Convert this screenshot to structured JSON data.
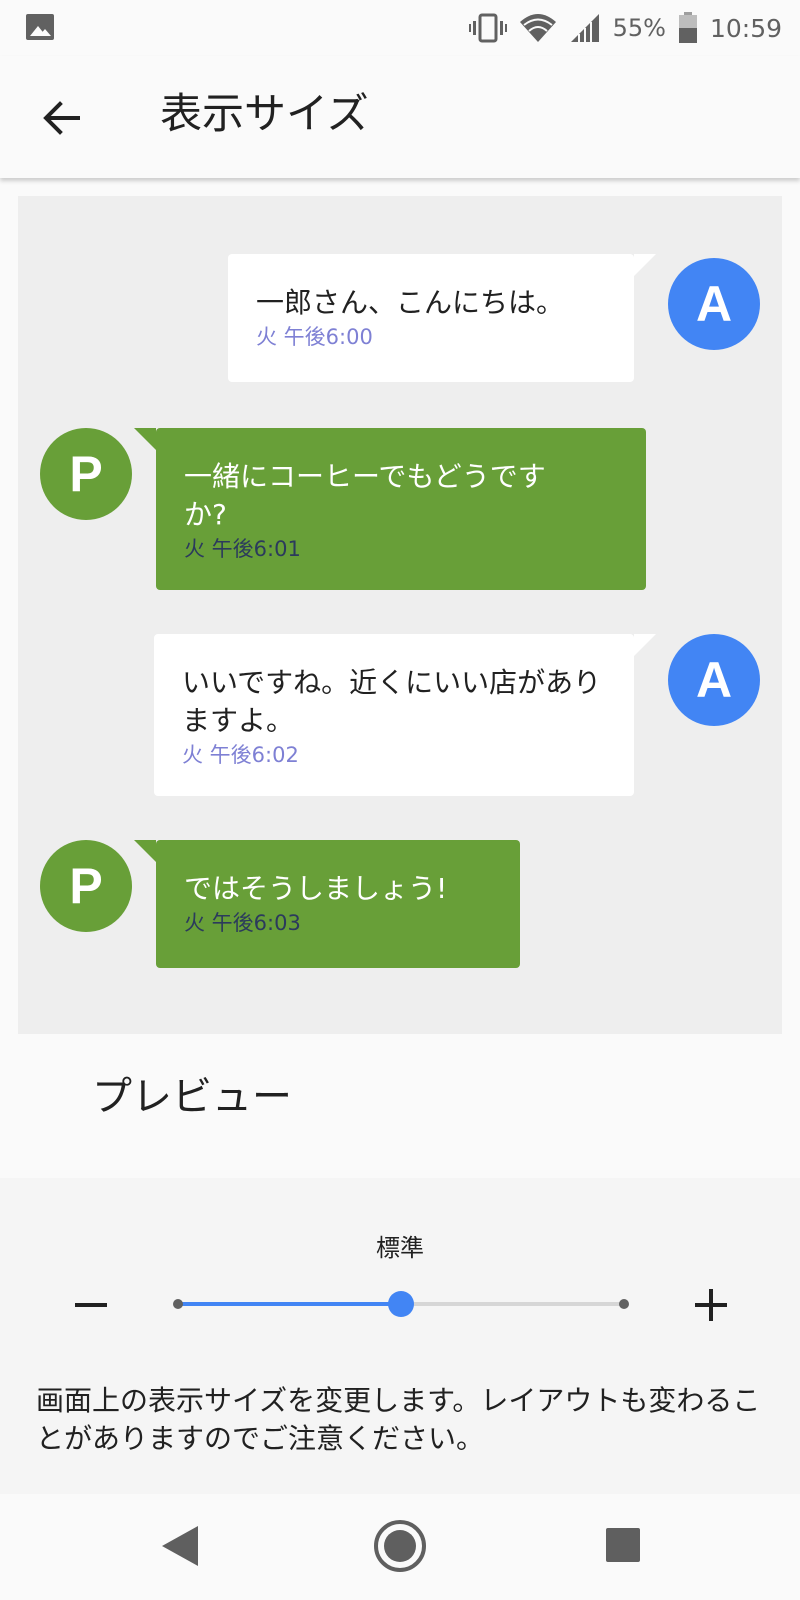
{
  "status_bar": {
    "battery_percent": "55%",
    "time": "10:59",
    "icons": [
      "image-icon",
      "vibrate-icon",
      "wifi-icon",
      "signal-icon",
      "battery-icon"
    ]
  },
  "app_bar": {
    "title": "表示サイズ",
    "back_icon": "arrow-back-icon"
  },
  "preview": {
    "messages": [
      {
        "sender": "A",
        "text": "一郎さん、こんにちは。",
        "time": "火 午後6:00"
      },
      {
        "sender": "P",
        "text": "一緒にコーヒーでもどうですか?",
        "time": "火 午後6:01"
      },
      {
        "sender": "A",
        "text": "いいですね。近くにいい店がありますよ。",
        "time": "火 午後6:02"
      },
      {
        "sender": "P",
        "text": "ではそうしましょう!",
        "time": "火 午後6:03"
      }
    ],
    "label": "プレビュー"
  },
  "size_control": {
    "current_label": "標準",
    "slider_value": 0.5,
    "description": "画面上の表示サイズを変更します。レイアウトも変わることがありますのでご注意ください。"
  },
  "nav_bar": {
    "icons": [
      "nav-back-icon",
      "nav-home-icon",
      "nav-recents-icon"
    ]
  },
  "colors": {
    "accent": "#4285f4",
    "avatar_a": "#4285f4",
    "avatar_p": "#689f38",
    "green_bubble": "#689f38",
    "white_bubble_time": "#7e80d4",
    "green_bubble_time": "#2b3a5c"
  }
}
